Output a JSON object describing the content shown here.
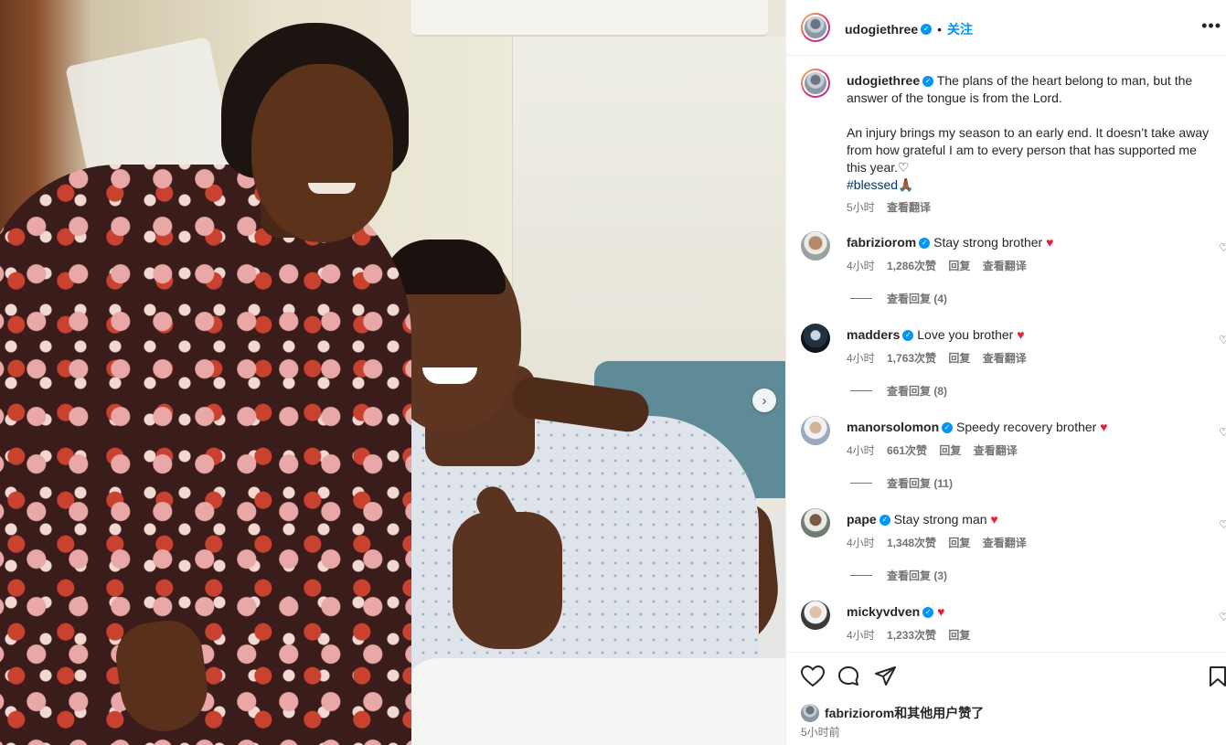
{
  "post": {
    "next_icon": "chevron-right-icon"
  },
  "header": {
    "username": "udogiethree",
    "separator": "•",
    "follow_label": "关注",
    "more_icon": "more-horizontal-icon"
  },
  "caption": {
    "username": "udogiethree",
    "line1": "The plans of the heart belong to man, but the answer of the tongue is from the Lord.",
    "line2": "An injury brings my season to an early end. It doesn’t take away from how grateful I am to every person that has supported me this year.",
    "heart": "♡",
    "hashtag": "#blessed",
    "emoji": "🙏🏾",
    "time": "5小时",
    "translate": "查看翻译"
  },
  "comments": [
    {
      "username": "fabriziorom",
      "text": "Stay strong brother",
      "time": "4小时",
      "likes": "1,286次赞",
      "reply": "回复",
      "translate": "查看翻译",
      "replies": "查看回复 (4)"
    },
    {
      "username": "madders",
      "text": "Love you brother",
      "time": "4小时",
      "likes": "1,763次赞",
      "reply": "回复",
      "translate": "查看翻译",
      "replies": "查看回复 (8)"
    },
    {
      "username": "manorsolomon",
      "text": "Speedy recovery brother",
      "time": "4小时",
      "likes": "661次赞",
      "reply": "回复",
      "translate": "查看翻译",
      "replies": "查看回复 (11)"
    },
    {
      "username": "pape",
      "text": "Stay strong man",
      "time": "4小时",
      "likes": "1,348次赞",
      "reply": "回复",
      "translate": "查看翻译",
      "replies": "查看回复 (3)"
    },
    {
      "username": "mickyvdven",
      "text": "",
      "time": "4小时",
      "likes": "1,233次赞",
      "reply": "回复",
      "translate": "",
      "replies": ""
    }
  ],
  "footer": {
    "liked_by": "fabriziorom和其他用户赞了",
    "time_ago": "5小时前"
  },
  "colors": {
    "accent": "#0095f6",
    "heart": "#ed1e3a",
    "muted": "#737373"
  }
}
